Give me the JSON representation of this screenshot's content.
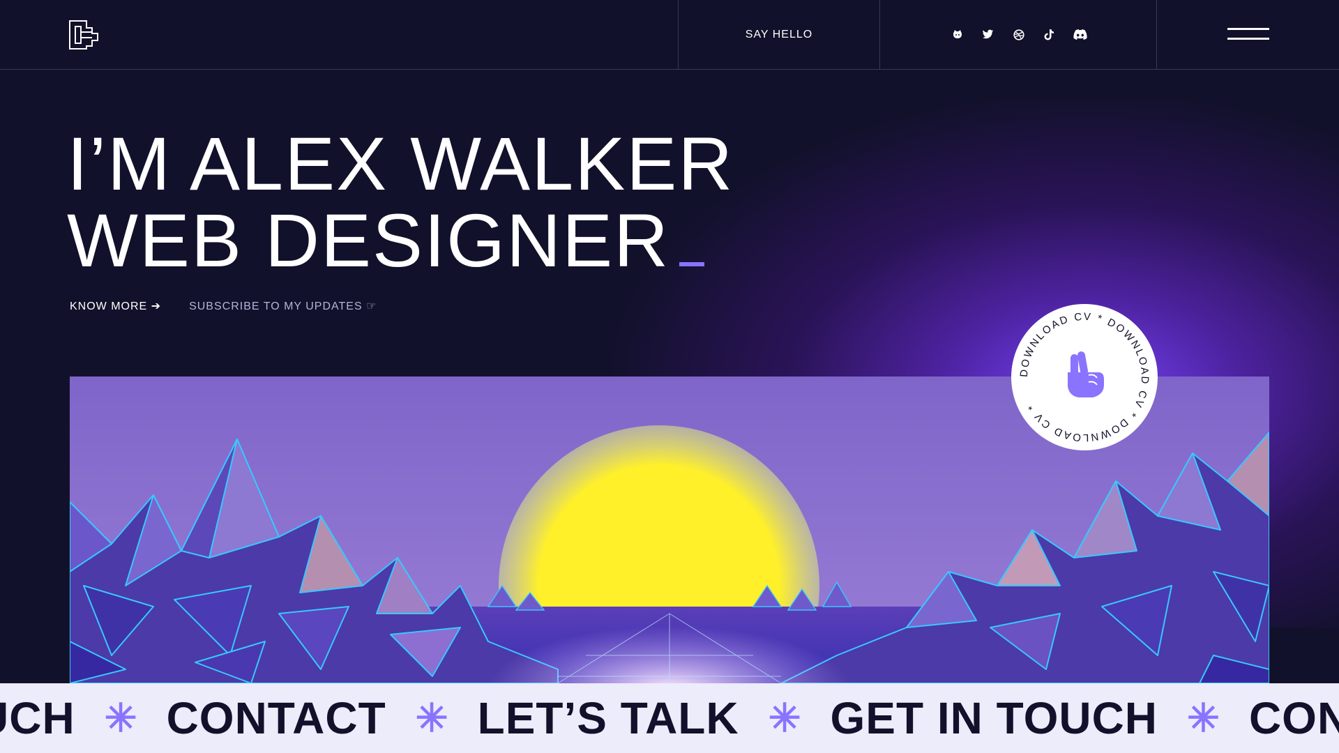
{
  "header": {
    "say_hello": "SAY HELLO",
    "social_icons": [
      "github-icon",
      "twitter-icon",
      "dribbble-icon",
      "tiktok-icon",
      "discord-icon"
    ],
    "logo_icon": "logo-icon",
    "menu_icon": "hamburger-menu-icon"
  },
  "hero": {
    "title_line1": "I’M ALEX WALKER",
    "title_line2": "WEB DESIGNER",
    "know_more": "KNOW MORE",
    "know_more_icon": "arrow-right-icon",
    "subscribe": "SUBSCRIBE TO MY UPDATES",
    "subscribe_icon": "pointing-hand-icon"
  },
  "badge": {
    "ring_text": "DOWNLOAD CV * DOWNLOAD CV * DOWNLOAD CV * ",
    "icon": "peace-hand-icon"
  },
  "marquee": {
    "items": [
      "UCH",
      "CONTACT",
      "LET’S TALK",
      "GET IN TOUCH",
      "CONTACT"
    ],
    "separator": "✳"
  },
  "colors": {
    "background": "#12112b",
    "accent": "#8a73ff",
    "marquee_bg": "#edecfb",
    "sun": "#fff02a"
  }
}
